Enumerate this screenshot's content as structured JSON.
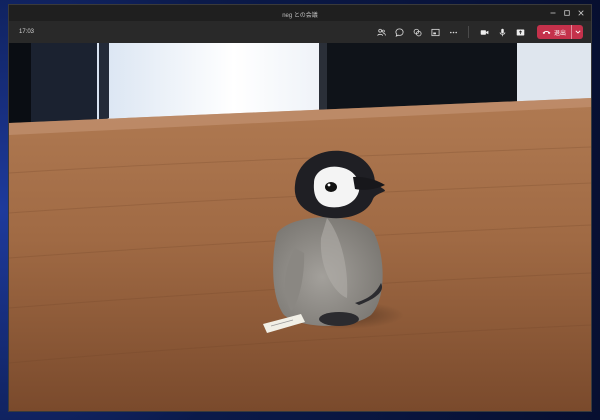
{
  "window": {
    "title": "neg との会議"
  },
  "toolbar": {
    "timer": "17:03",
    "icons": [
      "participants-icon",
      "chat-icon",
      "reactions-icon",
      "view-icon",
      "more-icon",
      "camera-icon",
      "mic-icon",
      "share-icon"
    ],
    "leave_label": "退出"
  },
  "colors": {
    "leave_button": "#c4314b",
    "toolbar_bg": "#292929",
    "titlebar_bg": "#1f1f1f"
  }
}
